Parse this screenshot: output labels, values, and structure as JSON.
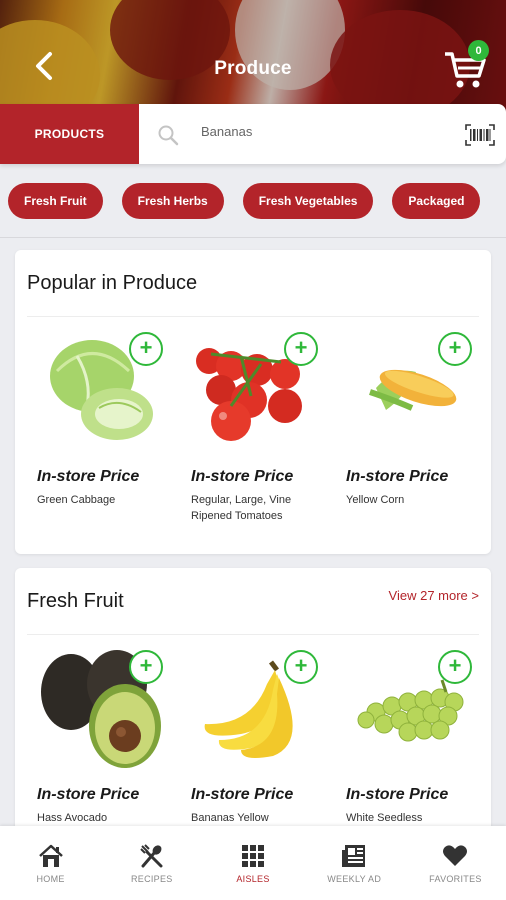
{
  "header": {
    "title": "Produce",
    "cart_count": "0"
  },
  "search": {
    "tab_label": "PRODUCTS",
    "value": "Bananas"
  },
  "categories": [
    "Fresh Fruit",
    "Fresh Herbs",
    "Fresh Vegetables",
    "Packaged"
  ],
  "sections": [
    {
      "title": "Popular in Produce",
      "view_more": "",
      "products": [
        {
          "price": "In-store Price",
          "name": "Green Cabbage",
          "image": "cabbage"
        },
        {
          "price": "In-store Price",
          "name": "Regular, Large, Vine Ripened Tomatoes",
          "image": "tomatoes"
        },
        {
          "price": "In-store Price",
          "name": "Yellow Corn",
          "image": "corn"
        }
      ]
    },
    {
      "title": "Fresh Fruit",
      "view_more": "View 27 more >",
      "products": [
        {
          "price": "In-store Price",
          "name": "Hass Avocado",
          "image": "avocado"
        },
        {
          "price": "In-store Price",
          "name": "Bananas Yellow",
          "image": "bananas"
        },
        {
          "price": "In-store Price",
          "name": "White Seedless",
          "image": "grapes"
        }
      ]
    }
  ],
  "nav": [
    {
      "label": "HOME",
      "icon": "home-icon",
      "active": false
    },
    {
      "label": "RECIPES",
      "icon": "utensils-icon",
      "active": false
    },
    {
      "label": "AISLES",
      "icon": "grid-icon",
      "active": true
    },
    {
      "label": "WEEKLY AD",
      "icon": "newspaper-icon",
      "active": false
    },
    {
      "label": "FAVORITES",
      "icon": "heart-icon",
      "active": false
    }
  ],
  "colors": {
    "brand": "#b3242a",
    "add": "#2fb83a"
  }
}
